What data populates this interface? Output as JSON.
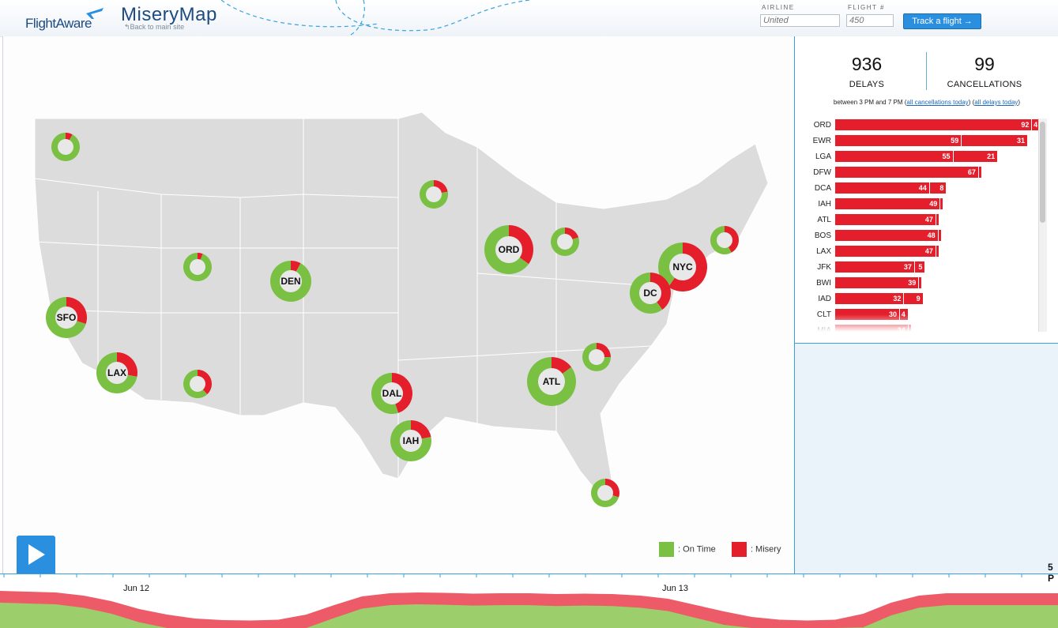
{
  "header": {
    "logo_text": "FlightAware",
    "title": "MiseryMap",
    "back_link": "↰Back to main site",
    "airline_label": "AIRLINE",
    "airline_placeholder": "United",
    "flight_label": "FLIGHT #",
    "flight_placeholder": "450",
    "track_button": "Track a flight →"
  },
  "colors": {
    "on_time": "#7ac143",
    "misery": "#e41e2b",
    "accent": "#2b8fe0"
  },
  "airports": [
    {
      "code": "",
      "misery": 0.08,
      "size": "small"
    },
    {
      "code": "",
      "misery": 0.22,
      "size": "small"
    },
    {
      "code": "",
      "misery": 0.06,
      "size": "small"
    },
    {
      "code": "DEN",
      "misery": 0.08,
      "size": "medium"
    },
    {
      "code": "SFO",
      "misery": 0.3,
      "size": "medium"
    },
    {
      "code": "LAX",
      "misery": 0.28,
      "size": "medium"
    },
    {
      "code": "",
      "misery": 0.38,
      "size": "small"
    },
    {
      "code": "ORD",
      "misery": 0.35,
      "size": "large"
    },
    {
      "code": "",
      "misery": 0.2,
      "size": "small"
    },
    {
      "code": "",
      "misery": 0.42,
      "size": "small"
    },
    {
      "code": "NYC",
      "misery": 0.6,
      "size": "large"
    },
    {
      "code": "DC",
      "misery": 0.4,
      "size": "medium"
    },
    {
      "code": "",
      "misery": 0.25,
      "size": "small"
    },
    {
      "code": "ATL",
      "misery": 0.15,
      "size": "large"
    },
    {
      "code": "DAL",
      "misery": 0.45,
      "size": "medium"
    },
    {
      "code": "IAH",
      "misery": 0.22,
      "size": "medium"
    },
    {
      "code": "",
      "misery": 0.3,
      "size": "small"
    }
  ],
  "legend": {
    "on_time": ": On Time",
    "misery": ": Misery"
  },
  "stats": {
    "delays": "936",
    "delays_label": "DELAYS",
    "cancellations": "99",
    "cancellations_label": "CANCELLATIONS",
    "between_text": "between 3 PM and 7 PM (",
    "link_cancellations": "all cancellations today",
    "link_delays": "all delays today",
    "mid_text": ") (",
    "end_text": ")"
  },
  "bars": [
    {
      "code": "ORD",
      "delays": 92,
      "cancellations": 4
    },
    {
      "code": "EWR",
      "delays": 59,
      "cancellations": 31
    },
    {
      "code": "LGA",
      "delays": 55,
      "cancellations": 21
    },
    {
      "code": "DFW",
      "delays": 67,
      "cancellations": null
    },
    {
      "code": "DCA",
      "delays": 44,
      "cancellations": 8
    },
    {
      "code": "IAH",
      "delays": 49,
      "cancellations": null
    },
    {
      "code": "ATL",
      "delays": 47,
      "cancellations": null
    },
    {
      "code": "BOS",
      "delays": 48,
      "cancellations": null
    },
    {
      "code": "LAX",
      "delays": 47,
      "cancellations": null
    },
    {
      "code": "JFK",
      "delays": 37,
      "cancellations": 5
    },
    {
      "code": "BWI",
      "delays": 39,
      "cancellations": null
    },
    {
      "code": "IAD",
      "delays": 32,
      "cancellations": 9
    },
    {
      "code": "CLT",
      "delays": 30,
      "cancellations": 4
    },
    {
      "code": "MIA",
      "delays": 34,
      "cancellations": null
    }
  ],
  "timeline": {
    "labels": [
      "Jun 12",
      "Jun 13"
    ],
    "current_time": "5 P",
    "misery_levels": [
      0.78,
      0.76,
      0.74,
      0.66,
      0.52,
      0.32,
      0.18,
      0.08,
      0.04,
      0.03,
      0.05,
      0.18,
      0.42,
      0.64,
      0.72,
      0.74,
      0.73,
      0.71,
      0.72,
      0.72,
      0.7,
      0.71,
      0.7,
      0.66,
      0.58,
      0.42,
      0.26,
      0.12,
      0.05,
      0.03,
      0.05,
      0.2,
      0.48,
      0.66,
      0.72,
      0.72,
      0.72,
      0.72,
      0.72
    ]
  }
}
